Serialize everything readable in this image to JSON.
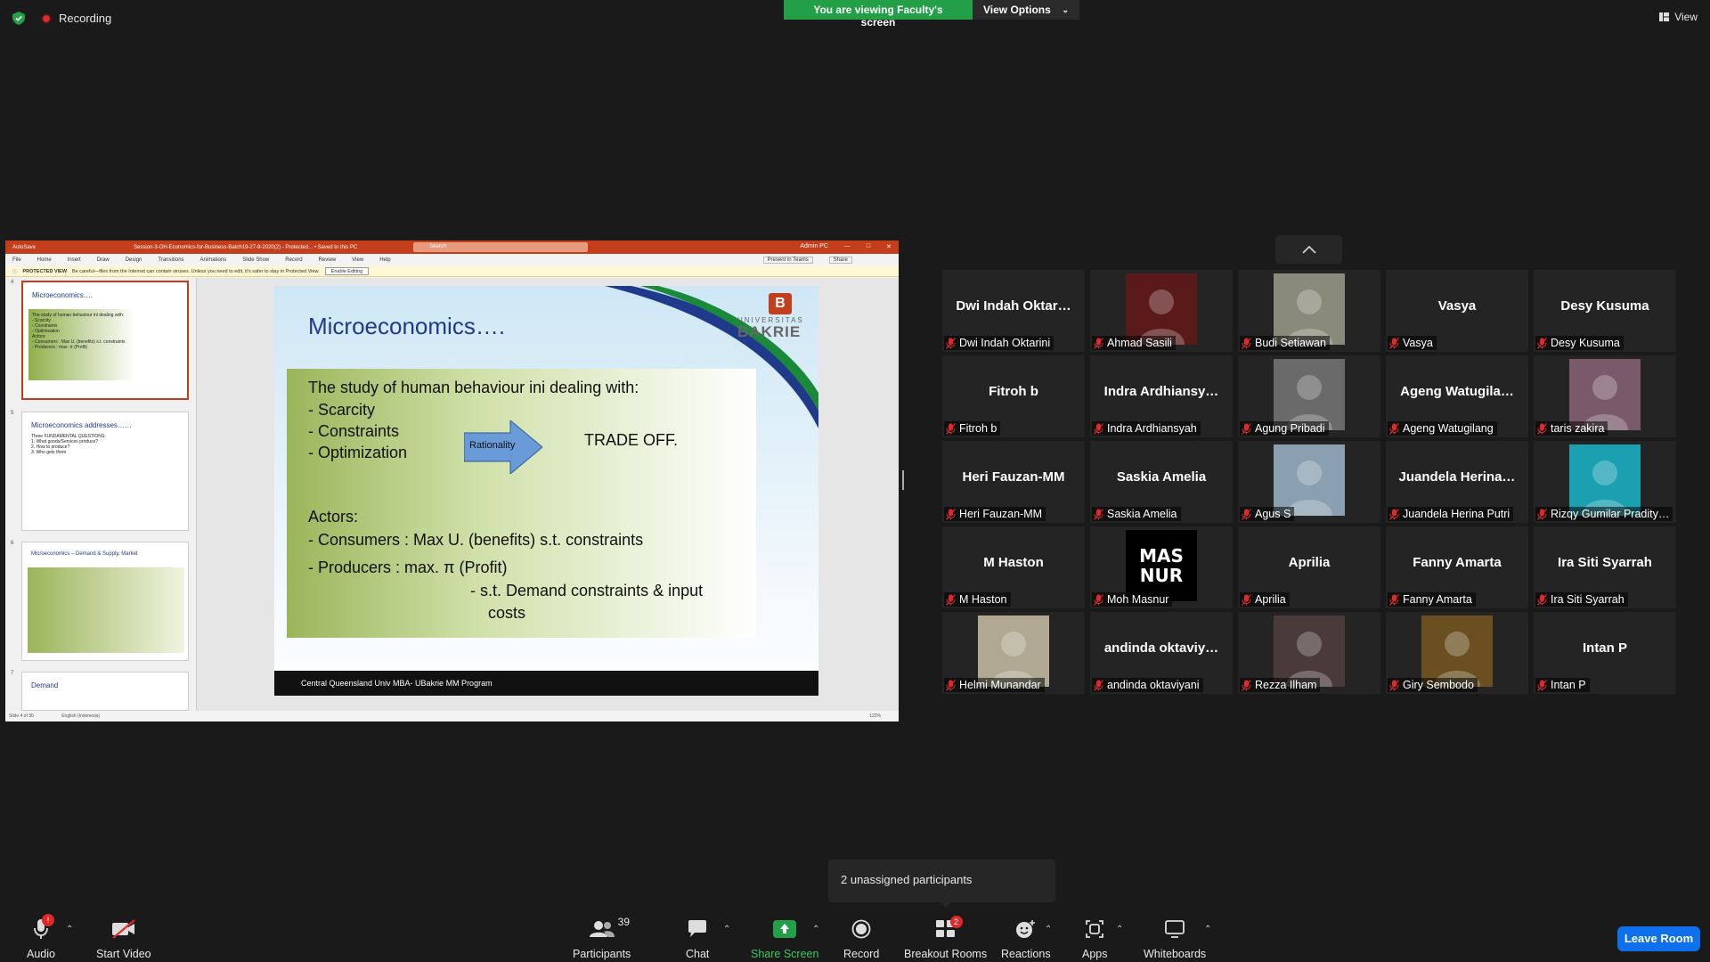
{
  "topbar": {
    "recording_label": "Recording",
    "viewing_label": "You are viewing Faculty's screen",
    "view_options_label": "View Options",
    "view_label": "View"
  },
  "ppt": {
    "title_bar": "Session-3-OH-Economics-for-Business-Batch19-27-9-2020(2) - Protected... • Saved to this PC",
    "autosave": "AutoSave",
    "search_placeholder": "Search",
    "user": "Admin PC",
    "menu": [
      "File",
      "Home",
      "Insert",
      "Draw",
      "Design",
      "Transitions",
      "Animations",
      "Slide Show",
      "Record",
      "Review",
      "View",
      "Help"
    ],
    "protected_title": "PROTECTED VIEW",
    "protected_msg": "Be careful—files from the Internet can contain viruses. Unless you need to edit, it's safer to stay in Protected View.",
    "enable_editing": "Enable Editing",
    "present_in_teams": "Present in Teams",
    "share": "Share",
    "status_left": "Slide 4 of 30",
    "status_lang": "English (Indonesia)",
    "zoom": "122%"
  },
  "thumbnails": [
    {
      "num": "4",
      "title": "Microeconomics….",
      "text": "The study of human behaviour ini dealing with:\n- Scarcity\n- Constraints\n- Optimization\nActors:\n- Consumers : Max U. (benefits) s.t. constraints\n- Producers : max. π (Profit)"
    },
    {
      "num": "5",
      "title": "Microeconomics addresses……",
      "text": "Three FUNDAMENTAL QUESTIONS:\n1. What goods/Services produce?\n2. How to produce?\n3. Who gets them"
    },
    {
      "num": "6",
      "title": "Microeconomics – Demand & Supply, Market",
      "text": ""
    },
    {
      "num": "7",
      "title": "Demand",
      "text": ""
    }
  ],
  "slide": {
    "title": "Microeconomics….",
    "logo_line1": "UNIVERSITAS",
    "logo_line2": "BAKRIE",
    "line1": "The study of human behaviour ini dealing with:",
    "bullet1": "-   Scarcity",
    "bullet2": "-   Constraints",
    "bullet3": "-   Optimization",
    "rationality": "Rationality",
    "tradeoff": "TRADE OFF.",
    "actors": "Actors:",
    "consumers": "- Consumers : Max U. (benefits) s.t. constraints",
    "producers": "- Producers   : max. π (Profit)",
    "sub1": "-  s.t. Demand constraints & input",
    "sub2": "costs",
    "footer": "Central Queensland Univ MBA- UBakrie MM Program"
  },
  "participants_grid": [
    {
      "big": "Dwi  Indah  Oktar…",
      "label": "Dwi Indah Oktarini",
      "video": false
    },
    {
      "big": "",
      "label": "Ahmad Sasili",
      "video": true,
      "color": "#5a1a1a"
    },
    {
      "big": "",
      "label": "Budi Setiawan",
      "video": true,
      "color": "#8a8a7a"
    },
    {
      "big": "Vasya",
      "label": "Vasya",
      "video": false
    },
    {
      "big": "Desy Kusuma",
      "label": "Desy Kusuma",
      "video": false
    },
    {
      "big": "Fitroh b",
      "label": "Fitroh b",
      "video": false
    },
    {
      "big": "Indra  Ardhiansy…",
      "label": "Indra Ardhiansyah",
      "video": false
    },
    {
      "big": "",
      "label": "Agung Pribadi",
      "video": true,
      "color": "#6a6a6a"
    },
    {
      "big": "Ageng  Watugila…",
      "label": "Ageng Watugilang",
      "video": false
    },
    {
      "big": "",
      "label": "taris zakira",
      "video": true,
      "color": "#7a5a6a"
    },
    {
      "big": "Heri Fauzan-MM",
      "label": "Heri Fauzan-MM",
      "video": false
    },
    {
      "big": "Saskia Amelia",
      "label": "Saskia Amelia",
      "video": false
    },
    {
      "big": "",
      "label": "Agus S",
      "video": true,
      "color": "#8aa0b0"
    },
    {
      "big": "Juandela  Herina…",
      "label": "Juandela Herina Putri",
      "video": false
    },
    {
      "big": "",
      "label": "Rizqy Gumilar Pradity…",
      "video": true,
      "color": "#1aa0b0"
    },
    {
      "big": "M Haston",
      "label": "M Haston",
      "video": false
    },
    {
      "big": "",
      "label": "Moh Masnur",
      "video": true,
      "color": "#000000",
      "logo_line1": "MAS",
      "logo_line2": "NUR"
    },
    {
      "big": "Aprilia",
      "label": "Aprilia",
      "video": false
    },
    {
      "big": "Fanny Amarta",
      "label": "Fanny Amarta",
      "video": false
    },
    {
      "big": "Ira Siti Syarrah",
      "label": "Ira Siti Syarrah",
      "video": false
    },
    {
      "big": "",
      "label": "Helmi Munandar",
      "video": true,
      "color": "#b0a890"
    },
    {
      "big": "andinda  oktaviy…",
      "label": "andinda oktaviyani",
      "video": false
    },
    {
      "big": "",
      "label": "Rezza Ilham",
      "video": true,
      "color": "#4a3a3a"
    },
    {
      "big": "",
      "label": "Giry Sembodo",
      "video": true,
      "color": "#6a5020"
    },
    {
      "big": "Intan P",
      "label": "Intan P",
      "video": false
    }
  ],
  "tooltip": {
    "text": "2 unassigned participants"
  },
  "toolbar": {
    "audio": "Audio",
    "start_video": "Start Video",
    "participants": "Participants",
    "participants_count": "39",
    "chat": "Chat",
    "share_screen": "Share Screen",
    "record": "Record",
    "breakout_rooms": "Breakout Rooms",
    "breakout_badge": "2",
    "reactions": "Reactions",
    "apps": "Apps",
    "whiteboards": "Whiteboards",
    "leave_room": "Leave Room",
    "audio_badge": "!"
  },
  "colors": {
    "accent_green": "#23a047",
    "leave_blue": "#0e71eb",
    "ppt_red": "#c43e1c",
    "mute_red": "#e02828"
  }
}
